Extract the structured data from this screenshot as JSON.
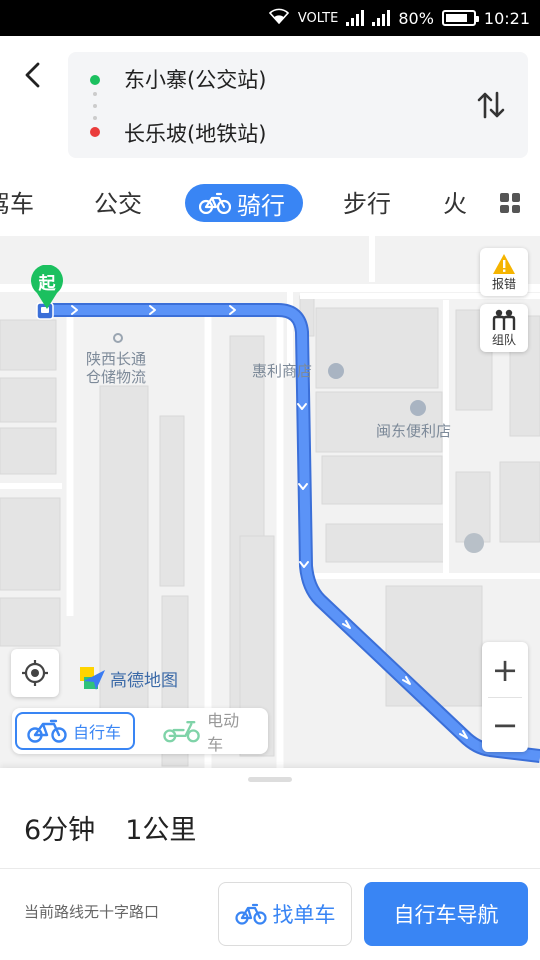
{
  "status_bar": {
    "network": "VOLTE",
    "battery": "80%",
    "time": "10:21"
  },
  "route": {
    "start": "东小寨(公交站)",
    "end": "长乐坡(地铁站)"
  },
  "tabs": [
    {
      "label": "驾车",
      "visible_text": "驾车",
      "active": false
    },
    {
      "label": "公交",
      "active": false
    },
    {
      "label": "骑行",
      "active": true
    },
    {
      "label": "步行",
      "active": false
    },
    {
      "label": "火车",
      "visible_text": "火",
      "active": false
    }
  ],
  "map": {
    "start_marker": "起",
    "pois": [
      {
        "name": "陕西长通仓储物流"
      },
      {
        "name": "惠利商店"
      },
      {
        "name": "闽东便利店"
      }
    ],
    "report_label": "报错",
    "team_label": "组队",
    "zoom_in": "+",
    "zoom_out": "−",
    "logo_text": "高德地图",
    "route_color": "#4f8ef7"
  },
  "vehicle_toggle": {
    "bicycle": "自行车",
    "ebike": "电动车",
    "selected": "bicycle"
  },
  "summary": {
    "duration": "6分钟",
    "distance": "1公里"
  },
  "footer": {
    "hint": "当前路线无十字路口",
    "find_bike": "找单车",
    "navigate": "自行车导航"
  },
  "colors": {
    "accent": "#3985f4",
    "start_dot": "#1bc05f",
    "end_dot": "#ea3c3c"
  }
}
